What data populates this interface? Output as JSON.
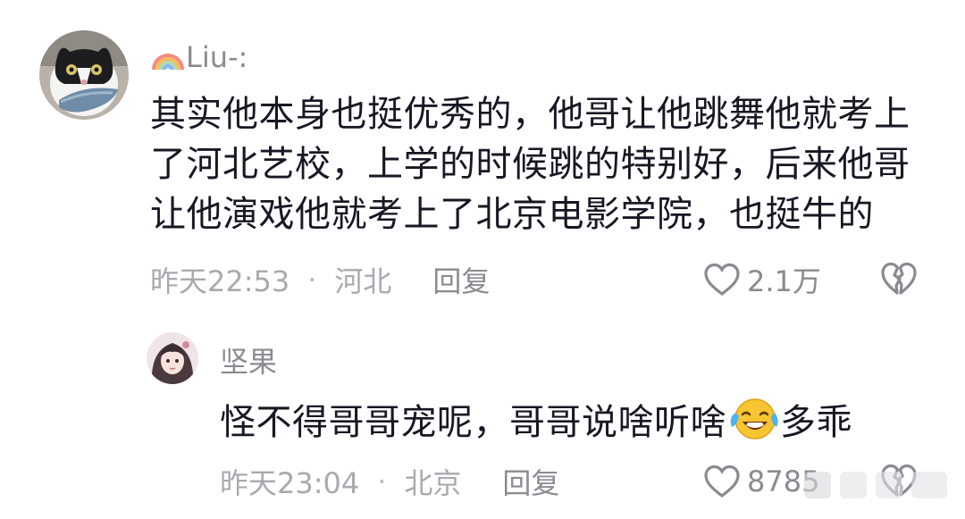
{
  "comments": [
    {
      "username": "Liu-:",
      "username_icon": "rainbow-icon",
      "avatar": "cat-avatar",
      "content": "其实他本身也挺优秀的，他哥让他跳舞他就考上了河北艺校，上学的时候跳的特别好，后来他哥让他演戏他就考上了北京电影学院，也挺牛的",
      "time": "昨天22:53",
      "separator": "·",
      "location": "河北",
      "reply_label": "回复",
      "likes": "2.1万"
    },
    {
      "username": "坚果",
      "avatar": "girl-avatar",
      "content_before_emoji": "怪不得哥哥宠呢，哥哥说啥听啥",
      "emoji": "laughing-crying-emoji",
      "content_after_emoji": "多乖",
      "time": "昨天23:04",
      "separator": "·",
      "location": "北京",
      "reply_label": "回复",
      "likes": "8785"
    }
  ],
  "colors": {
    "text": "#161823",
    "meta": "#a9aab0",
    "username": "#8a8b91"
  }
}
